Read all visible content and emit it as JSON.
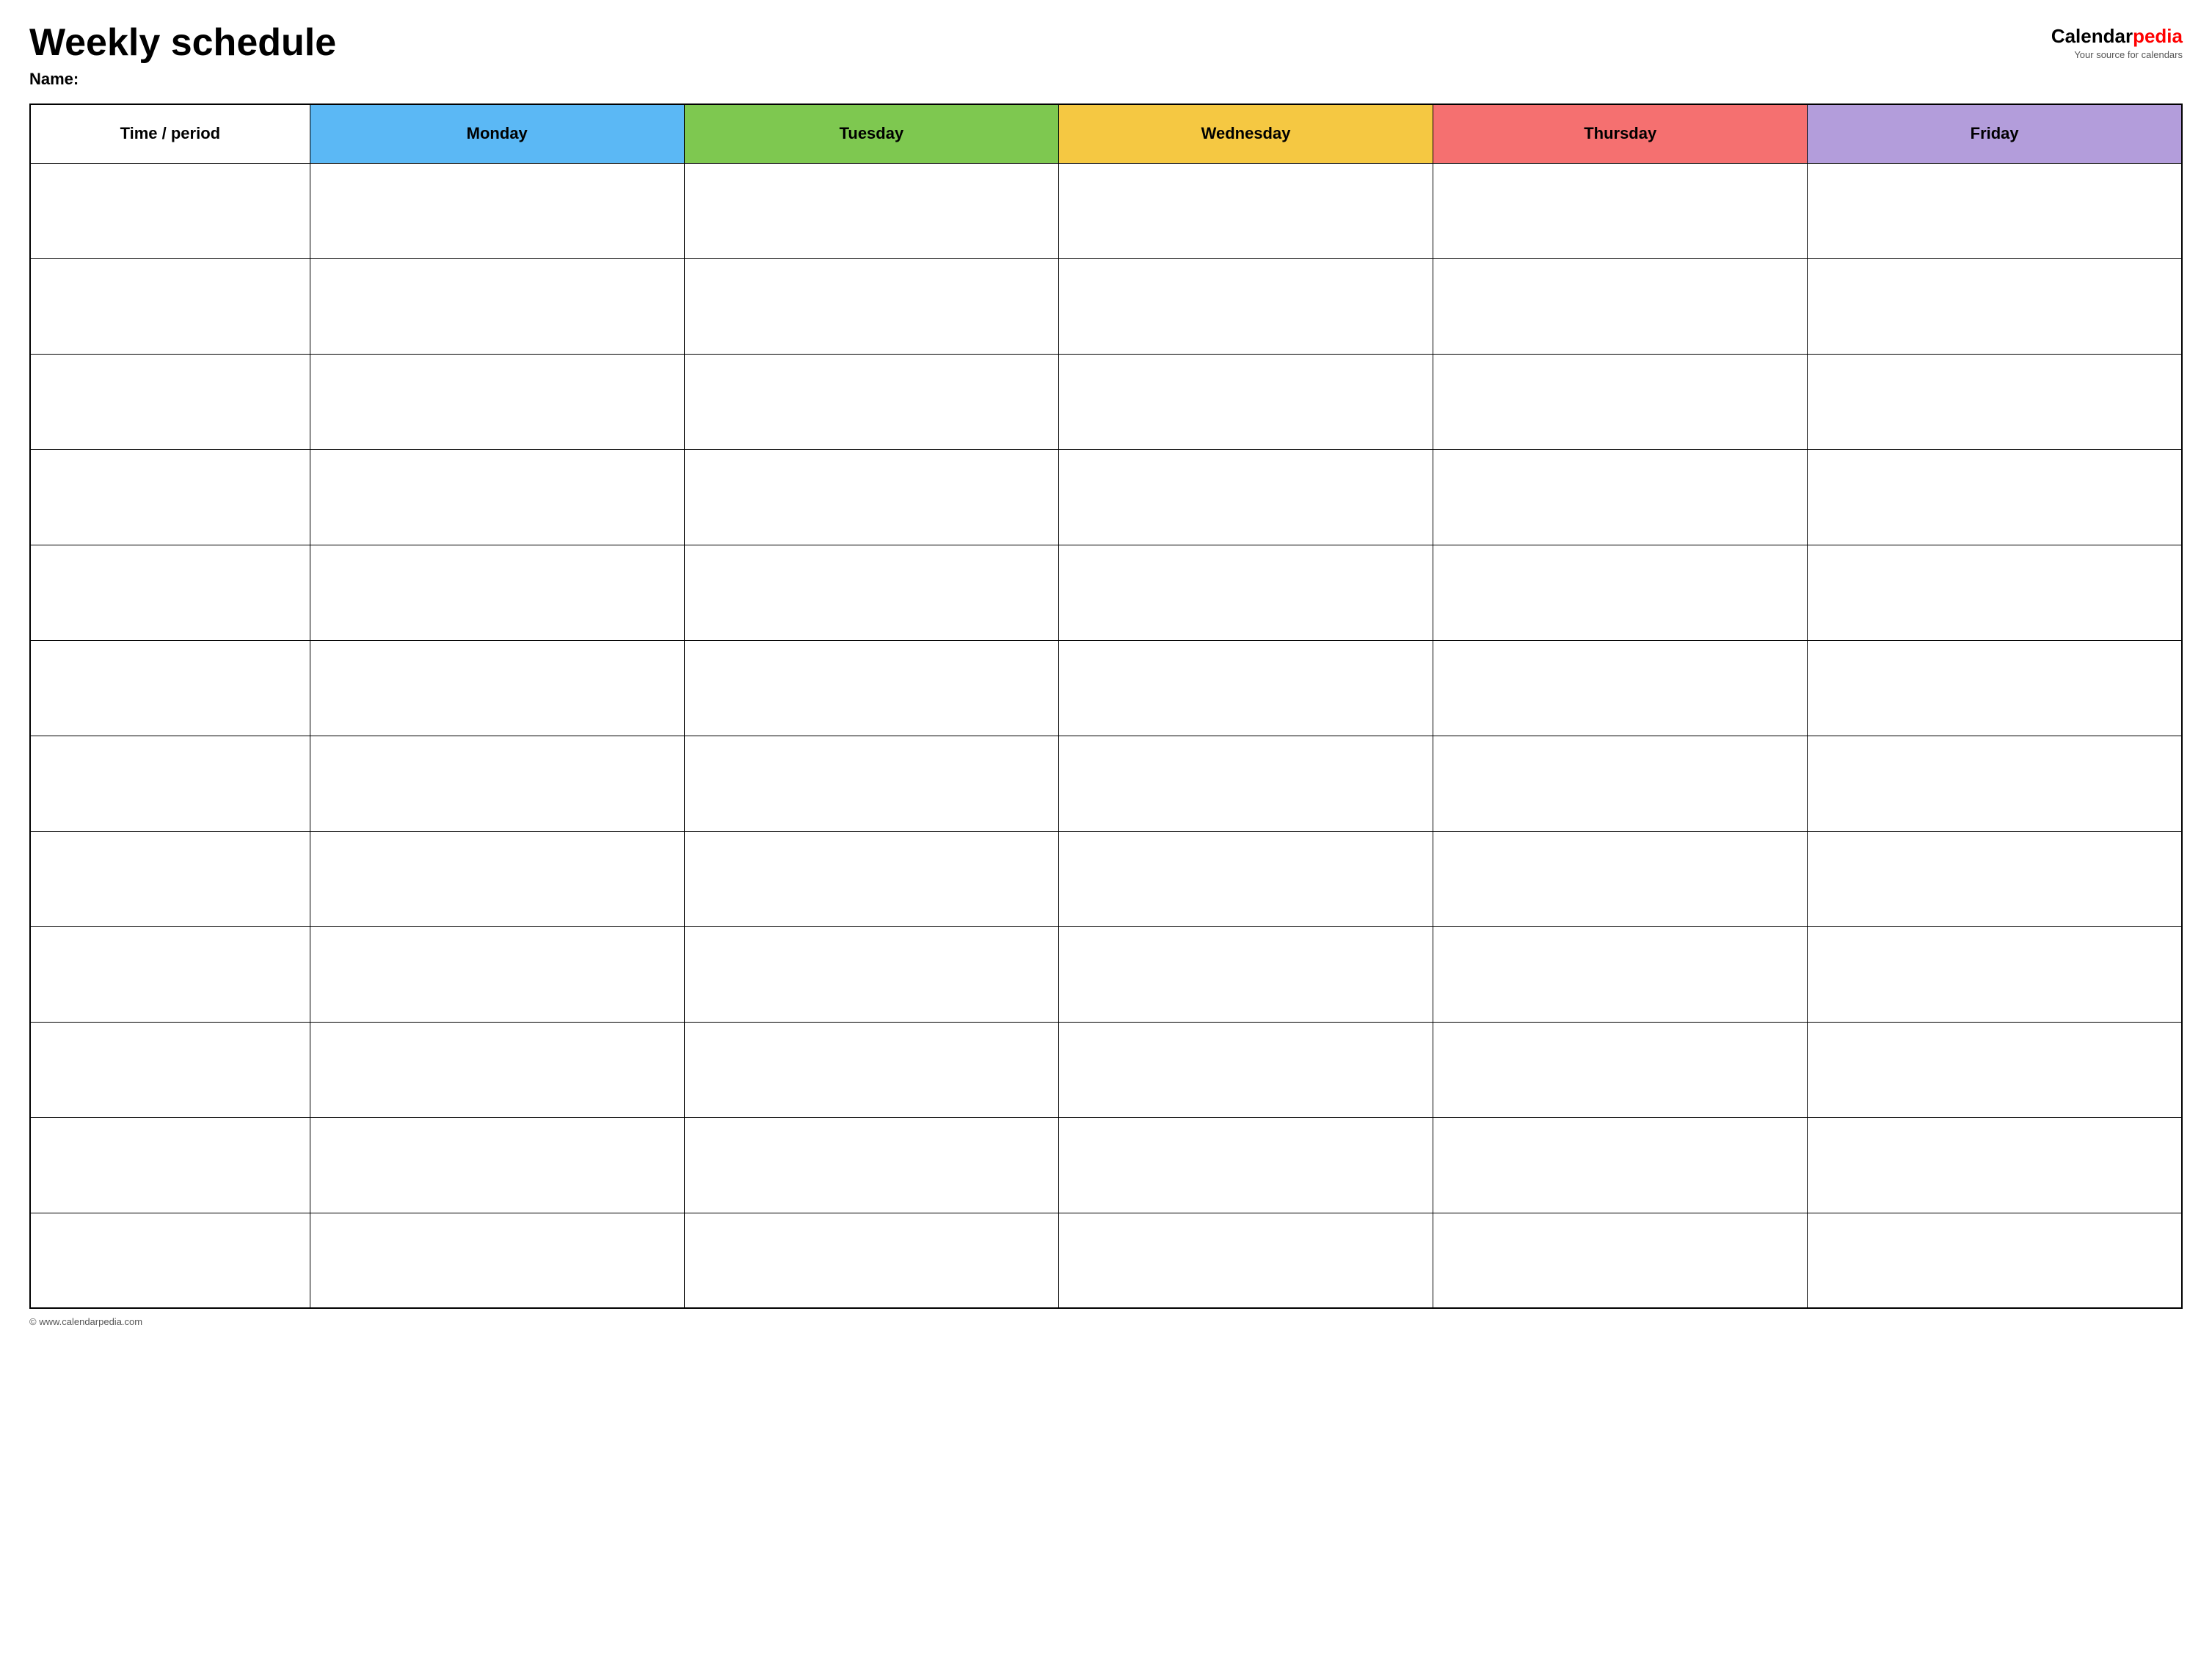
{
  "header": {
    "title": "Weekly schedule",
    "name_label": "Name:",
    "logo": {
      "calendar_part": "Calendar",
      "pedia_part": "pedia",
      "tagline": "Your source for calendars"
    }
  },
  "table": {
    "columns": [
      {
        "key": "time",
        "label": "Time / period",
        "color": "#ffffff"
      },
      {
        "key": "monday",
        "label": "Monday",
        "color": "#5bb8f5"
      },
      {
        "key": "tuesday",
        "label": "Tuesday",
        "color": "#7ec850"
      },
      {
        "key": "wednesday",
        "label": "Wednesday",
        "color": "#f5c842"
      },
      {
        "key": "thursday",
        "label": "Thursday",
        "color": "#f57070"
      },
      {
        "key": "friday",
        "label": "Friday",
        "color": "#b39ddb"
      }
    ],
    "row_count": 12
  },
  "footer": {
    "url": "© www.calendarpedia.com"
  }
}
